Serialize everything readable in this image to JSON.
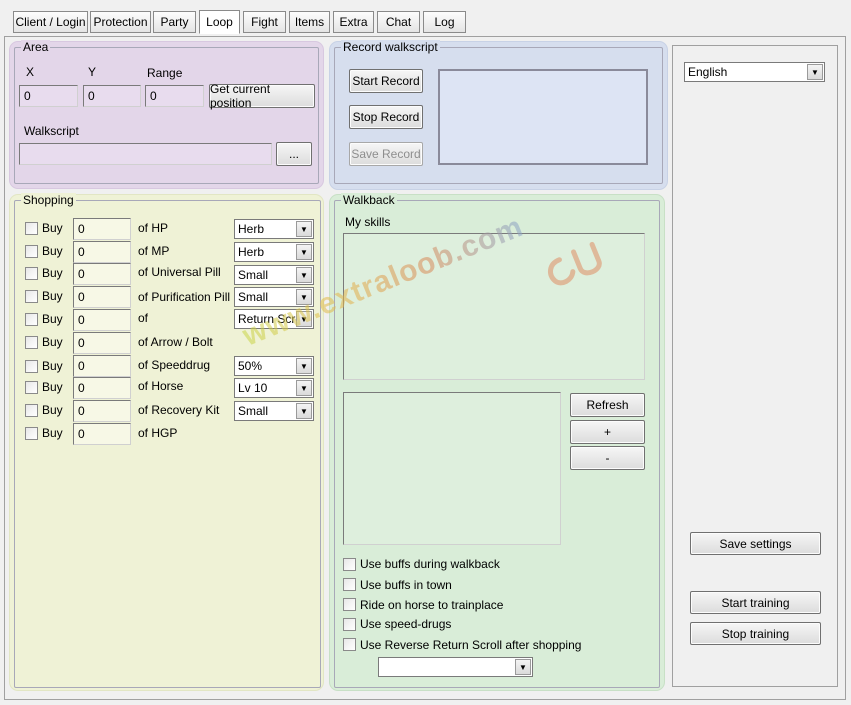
{
  "tabs": [
    "Client / Login",
    "Protection",
    "Party",
    "Loop",
    "Fight",
    "Items",
    "Extra",
    "Chat",
    "Log"
  ],
  "active_tab": "Loop",
  "area": {
    "title": "Area",
    "x_label": "X",
    "y_label": "Y",
    "range_label": "Range",
    "x_value": "0",
    "y_value": "0",
    "range_value": "0",
    "get_pos_button": "Get current position",
    "walkscript_label": "Walkscript",
    "walkscript_value": "",
    "browse_button": "..."
  },
  "record": {
    "title": "Record walkscript",
    "start_button": "Start Record",
    "stop_button": "Stop Record",
    "save_button": "Save Record"
  },
  "shopping": {
    "title": "Shopping",
    "buy_label": "Buy",
    "rows": [
      {
        "qty": "0",
        "item": "of HP",
        "select": "Herb"
      },
      {
        "qty": "0",
        "item": "of MP",
        "select": "Herb"
      },
      {
        "qty": "0",
        "item": "of Universal Pill",
        "select": "Small"
      },
      {
        "qty": "0",
        "item": "of Purification Pill",
        "select": "Small"
      },
      {
        "qty": "0",
        "item": "of",
        "select": "Return Scroll"
      },
      {
        "qty": "0",
        "item": "of Arrow / Bolt",
        "select": null
      },
      {
        "qty": "0",
        "item": "of Speeddrug",
        "select": "50%"
      },
      {
        "qty": "0",
        "item": "of Horse",
        "select": "Lv 10"
      },
      {
        "qty": "0",
        "item": "of Recovery Kit",
        "select": "Small"
      },
      {
        "qty": "0",
        "item": "of HGP",
        "select": null
      }
    ]
  },
  "walkback": {
    "title": "Walkback",
    "my_skills_label": "My skills",
    "refresh_button": "Refresh",
    "add_button": "+",
    "remove_button": "-",
    "options": [
      "Use buffs during walkback",
      "Use buffs in town",
      "Ride on horse to trainplace",
      "Use speed-drugs",
      "Use Reverse Return Scroll after shopping"
    ],
    "reverse_scroll_select": ""
  },
  "side": {
    "language": "English",
    "save_settings": "Save settings",
    "start_training": "Start training",
    "stop_training": "Stop training"
  },
  "watermark": "www.extraloob.com",
  "colors": {
    "area_bg": "#e3d6e9",
    "record_bg": "#d6deee",
    "shopping_bg": "#eff2d6",
    "walkback_bg": "#d9edd8"
  }
}
